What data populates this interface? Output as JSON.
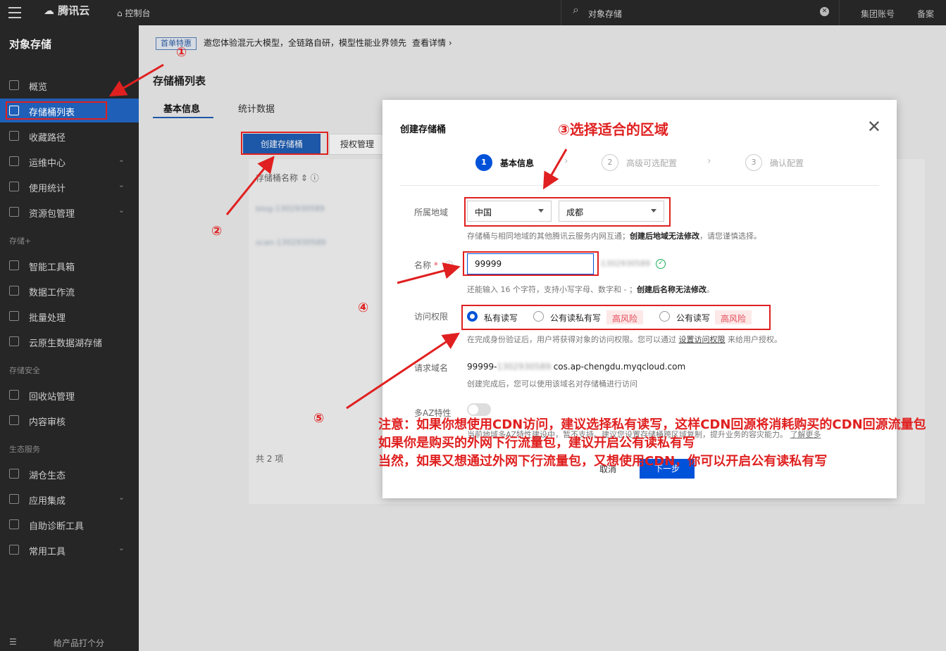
{
  "topbar": {
    "brand": "腾讯云",
    "console": "控制台",
    "search_text": "对象存储",
    "links": [
      "集团账号",
      "备案"
    ]
  },
  "sidebar": {
    "title": "对象存储",
    "items": [
      {
        "label": "概览",
        "icon": "grid-icon",
        "chevron": false
      },
      {
        "label": "存储桶列表",
        "icon": "bucket-icon",
        "chevron": false,
        "active": true
      },
      {
        "label": "收藏路径",
        "icon": "link-icon",
        "chevron": false
      },
      {
        "label": "运维中心",
        "icon": "calendar-icon",
        "chevron": true
      },
      {
        "label": "使用统计",
        "icon": "pie-icon",
        "chevron": true
      },
      {
        "label": "资源包管理",
        "icon": "package-icon",
        "chevron": true
      },
      {
        "label": "智能工具箱",
        "icon": "tool-icon",
        "chevron": false
      },
      {
        "label": "数据工作流",
        "icon": "flow-icon",
        "chevron": false
      },
      {
        "label": "批量处理",
        "icon": "check-icon",
        "chevron": false
      },
      {
        "label": "云原生数据湖存储",
        "icon": "lake-icon",
        "chevron": false
      },
      {
        "label": "回收站管理",
        "icon": "trash-icon",
        "chevron": false
      },
      {
        "label": "内容审核",
        "icon": "audit-icon",
        "chevron": false
      },
      {
        "label": "湖仓生态",
        "icon": "warehouse-icon",
        "chevron": false
      },
      {
        "label": "应用集成",
        "icon": "integration-icon",
        "chevron": true
      },
      {
        "label": "自助诊断工具",
        "icon": "diagnose-icon",
        "chevron": false
      },
      {
        "label": "常用工具",
        "icon": "toolbox-icon",
        "chevron": true
      }
    ],
    "groups": [
      "存储+",
      "存储安全",
      "生态服务"
    ],
    "bottom": "给产品打个分"
  },
  "main": {
    "notice_badge": "首单特惠",
    "notice_text": "邀您体验混元大模型，全链路自研，模型性能业界领先",
    "notice_more": "查看详情",
    "page_title": "存储桶列表",
    "tabs": [
      "基本信息",
      "统计数据"
    ],
    "create_button": "创建存储桶",
    "auth_button": "授权管理",
    "table_header": "存储桶名称",
    "rows": [
      "blog-1302930589",
      "scan-1302930589"
    ],
    "total": "共 2 项"
  },
  "modal": {
    "title": "创建存储桶",
    "steps": [
      {
        "num": "1",
        "label": "基本信息"
      },
      {
        "num": "2",
        "label": "高级可选配置"
      },
      {
        "num": "3",
        "label": "确认配置"
      }
    ],
    "region_label": "所属地域",
    "region_country": "中国",
    "region_city": "成都",
    "region_hint_a": "存储桶与相同地域的其他腾讯云服务内网互通；",
    "region_hint_b": "创建后地域无法修改",
    "region_hint_c": "，请您谨慎选择。",
    "name_label": "名称",
    "name_value": "99999",
    "name_suffix": "-1302930589",
    "name_hint_a": "还能输入 16 个字符，支持小写字母、数字和 - ；",
    "name_hint_b": "创建后名称无法修改",
    "name_hint_c": "。",
    "access_label": "访问权限",
    "access_options": [
      "私有读写",
      "公有读私有写",
      "公有读写"
    ],
    "risk_label": "高风险",
    "access_hint_a": "在完成身份验证后，用户将获得对象的访问权限。您可以通过",
    "access_hint_link": "设置访问权限",
    "access_hint_c": "来给用户授权。",
    "domain_label": "请求域名",
    "domain_prefix": "99999-",
    "domain_blur": "1302930589.",
    "domain_suffix": "cos.ap-chengdu.myqcloud.com",
    "domain_hint": "创建完成后，您可以使用该域名对存储桶进行访问",
    "az_label": "多AZ特性",
    "az_hint": "当前地域多AZ特性建设中，暂不支持。建议您设置存储桶跨区域复制，提升业务的容灾能力。",
    "az_link": "了解更多",
    "cancel": "取消",
    "next": "下一步"
  },
  "annotations": {
    "n1": "①",
    "n2": "②",
    "n3": "③选择适合的区域",
    "n4": "④",
    "n5": "⑤",
    "note1": "注意：如果你想使用CDN访问，建议选择私有读写，这样CDN回源将消耗购买的CDN回源流量包",
    "note2": "如果你是购买的外网下行流量包，建议开启公有读私有写",
    "note3": "当然，如果又想通过外网下行流量包，又想使用CDN，你可以开启公有读私有写"
  },
  "colors": {
    "accent": "#0052d9",
    "sidebar_active": "#1f5fb7",
    "annotation": "#e02020",
    "risk": "#e34d59"
  }
}
